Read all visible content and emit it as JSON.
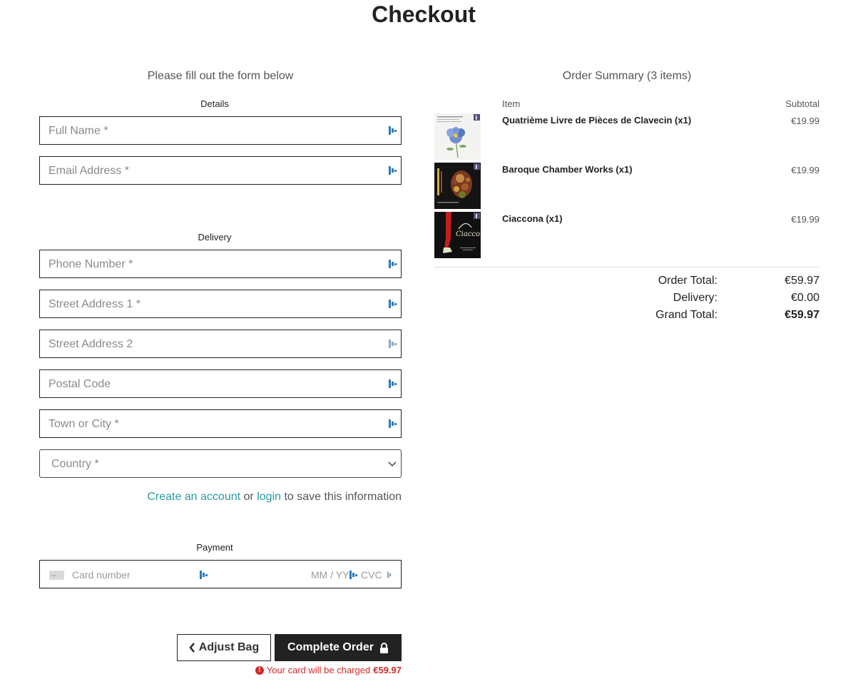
{
  "page": {
    "title": "Checkout"
  },
  "form": {
    "intro": "Please fill out the form below",
    "details_label": "Details",
    "full_name_placeholder": "Full Name *",
    "email_placeholder": "Email Address *",
    "delivery_label": "Delivery",
    "phone_placeholder": "Phone Number *",
    "street1_placeholder": "Street Address 1 *",
    "street2_placeholder": "Street Address 2",
    "postal_placeholder": "Postal Code",
    "town_placeholder": "Town or City *",
    "country_selected": "Country *",
    "save_info": {
      "create_account": "Create an account",
      "or": "or",
      "login": "login",
      "suffix": "to save this information"
    },
    "payment_label": "Payment",
    "card": {
      "number_placeholder": "Card number",
      "expiry_placeholder": "MM / YY",
      "cvc_placeholder": "CVC"
    },
    "buttons": {
      "adjust_bag": "Adjust Bag",
      "complete_order": "Complete Order"
    },
    "charge_note": {
      "text": "Your card will be charged",
      "amount": "€59.97",
      "color": "#d42a2a"
    }
  },
  "summary": {
    "title": "Order Summary (3 items)",
    "col_item": "Item",
    "col_subtotal": "Subtotal",
    "items": [
      {
        "name": "Quatrième Livre de Pièces de Clavecin (x1)",
        "price": "€19.99",
        "thumb": "blue-flower-cover"
      },
      {
        "name": "Baroque Chamber Works (x1)",
        "price": "€19.99",
        "thumb": "portrait-painting-cover"
      },
      {
        "name": "Ciaccona (x1)",
        "price": "€19.99",
        "thumb": "dancer-cover"
      }
    ],
    "order_total_label": "Order Total:",
    "order_total": "€59.97",
    "delivery_label": "Delivery:",
    "delivery": "€0.00",
    "grand_total_label": "Grand Total:",
    "grand_total": "€59.97"
  },
  "colors": {
    "accent_link": "#2a9ba0",
    "button_dark": "#222222",
    "error": "#d42a2a"
  }
}
